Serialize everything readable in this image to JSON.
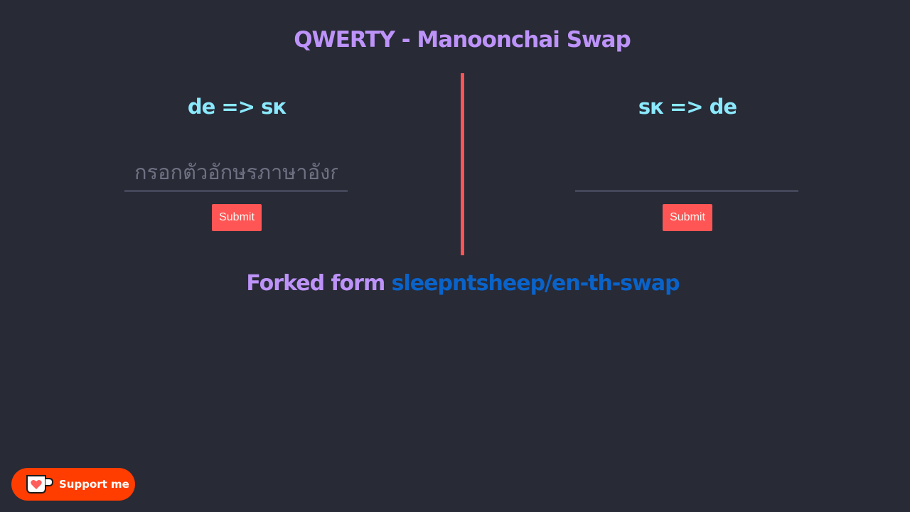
{
  "header": {
    "title": "QWERTY - Manoonchai Swap"
  },
  "panels": [
    {
      "heading": "de => sк",
      "input_placeholder": "กรอกตัวอักษรภาษาอังกฤษ",
      "input_value": "",
      "submit_label": "Submit"
    },
    {
      "heading": "sк => de",
      "input_placeholder": "",
      "input_value": "",
      "submit_label": "Submit"
    }
  ],
  "footer": {
    "prefix": "Forked form",
    "link_text": "sleepntsheep/en-th-swap"
  },
  "support_button": {
    "label": "Support me",
    "icon": "kofi-cup-heart-icon"
  },
  "colors": {
    "background": "#282a36",
    "title": "#bd93f9",
    "heading": "#8be9fd",
    "accent": "#ff5555",
    "link": "#0a63c9",
    "kofi": "#ff3d00"
  }
}
